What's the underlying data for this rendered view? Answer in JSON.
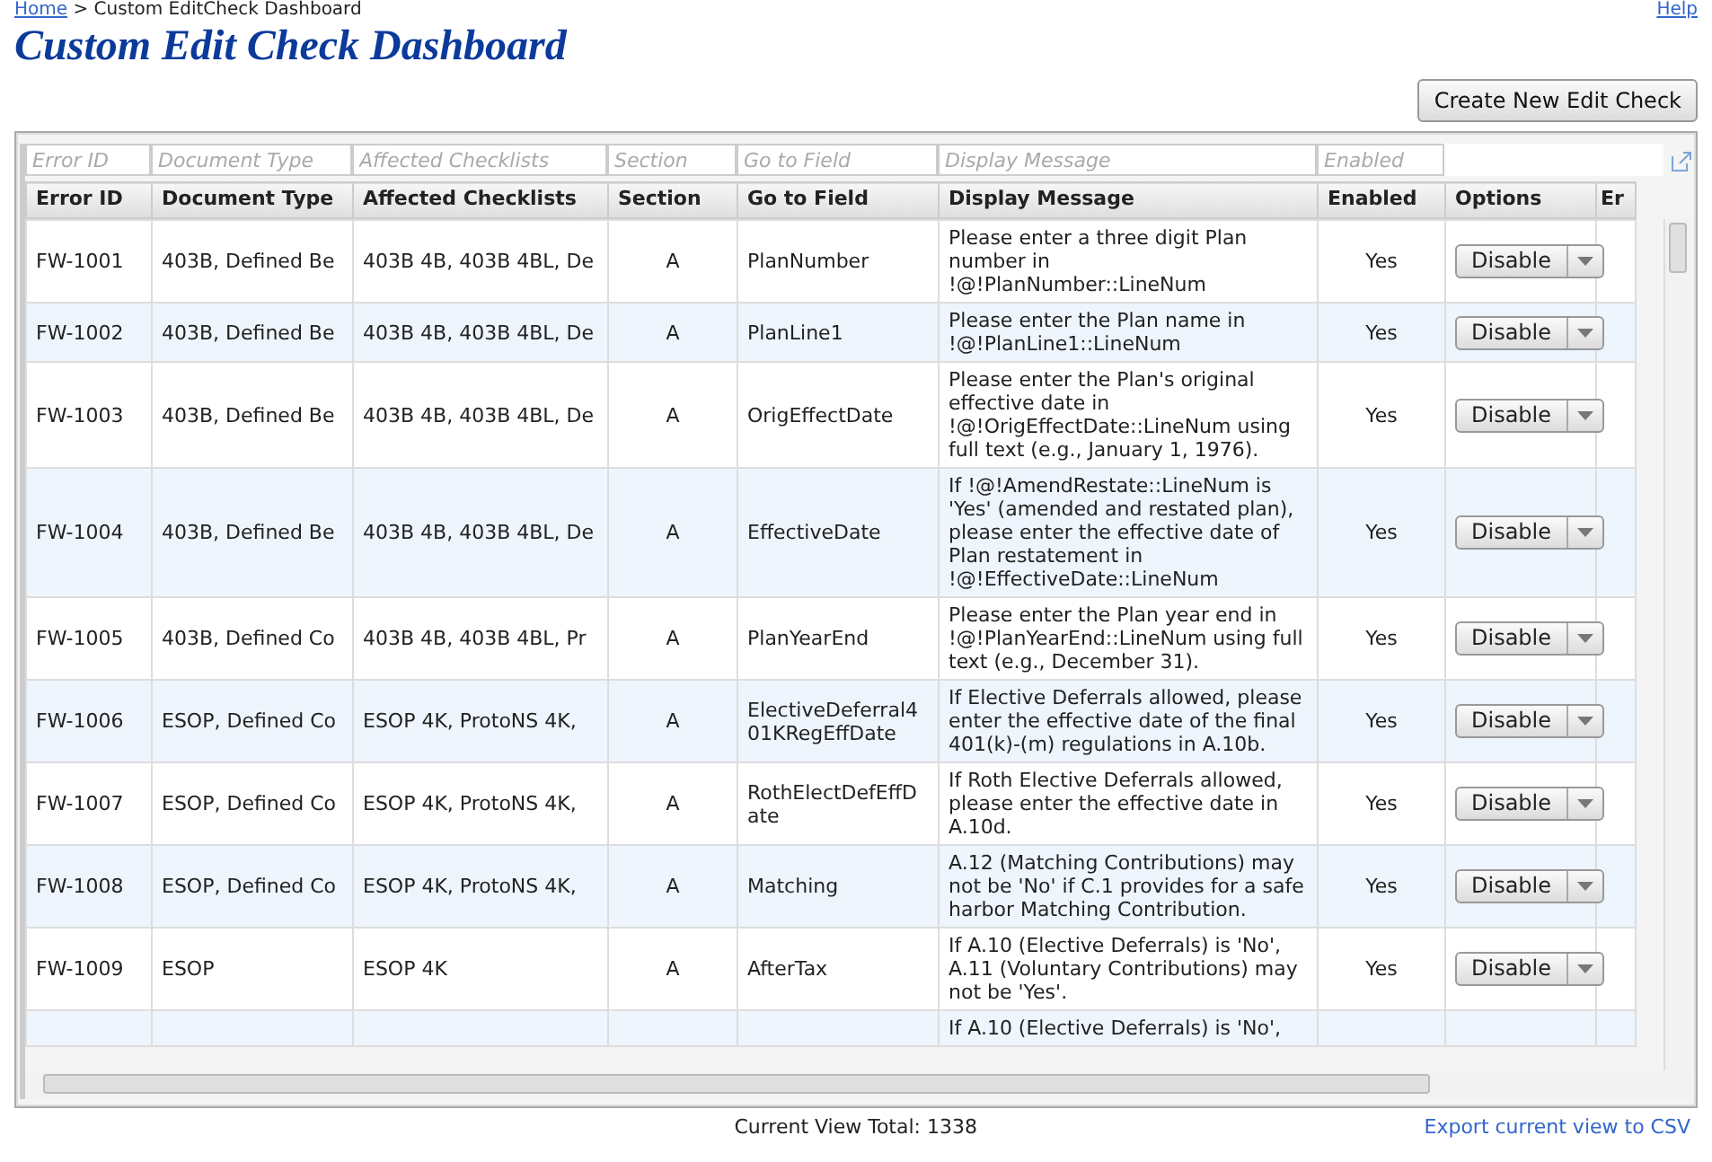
{
  "breadcrumb": {
    "home": "Home",
    "separator": ">",
    "current": "Custom EditCheck Dashboard"
  },
  "help_link": "Help",
  "title": "Custom Edit Check Dashboard",
  "create_button": "Create New Edit Check",
  "grid": {
    "filters": [
      {
        "placeholder": "Error ID"
      },
      {
        "placeholder": "Document Type"
      },
      {
        "placeholder": "Affected Checklists"
      },
      {
        "placeholder": "Section"
      },
      {
        "placeholder": "Go to Field"
      },
      {
        "placeholder": "Display Message"
      },
      {
        "placeholder": "Enabled"
      }
    ],
    "columns": [
      "Error ID",
      "Document Type",
      "Affected Checklists",
      "Section",
      "Go to Field",
      "Display Message",
      "Enabled",
      "Options",
      "Er"
    ],
    "rows": [
      {
        "error_id": "FW-1001",
        "document_type": "403B, Defined Be",
        "affected_checklists": "403B 4B, 403B 4BL, De",
        "section": "A",
        "go_to_field": "PlanNumber",
        "display_message": "Please enter a three digit Plan number in !@!PlanNumber::LineNum",
        "enabled": "Yes",
        "option": "Disable"
      },
      {
        "error_id": "FW-1002",
        "document_type": "403B, Defined Be",
        "affected_checklists": "403B 4B, 403B 4BL, De",
        "section": "A",
        "go_to_field": "PlanLine1",
        "display_message": "Please enter the Plan name in !@!PlanLine1::LineNum",
        "enabled": "Yes",
        "option": "Disable"
      },
      {
        "error_id": "FW-1003",
        "document_type": "403B, Defined Be",
        "affected_checklists": "403B 4B, 403B 4BL, De",
        "section": "A",
        "go_to_field": "OrigEffectDate",
        "display_message": "Please enter the Plan's original effective date in !@!OrigEffectDate::LineNum using full text (e.g., January 1, 1976).",
        "enabled": "Yes",
        "option": "Disable"
      },
      {
        "error_id": "FW-1004",
        "document_type": "403B, Defined Be",
        "affected_checklists": "403B 4B, 403B 4BL, De",
        "section": "A",
        "go_to_field": "EffectiveDate",
        "display_message": "If !@!AmendRestate::LineNum is 'Yes' (amended and restated plan), please enter the effective date of Plan restatement in !@!EffectiveDate::LineNum",
        "enabled": "Yes",
        "option": "Disable"
      },
      {
        "error_id": "FW-1005",
        "document_type": "403B, Defined Co",
        "affected_checklists": "403B 4B, 403B 4BL, Pr",
        "section": "A",
        "go_to_field": "PlanYearEnd",
        "display_message": "Please enter the Plan year end in !@!PlanYearEnd::LineNum using full text (e.g., December 31).",
        "enabled": "Yes",
        "option": "Disable"
      },
      {
        "error_id": "FW-1006",
        "document_type": "ESOP, Defined Co",
        "affected_checklists": "ESOP 4K, ProtoNS 4K,",
        "section": "A",
        "go_to_field": "ElectiveDeferral401KRegEffDate",
        "display_message": "If Elective Deferrals allowed, please enter the effective date of the final 401(k)-(m) regulations in A.10b.",
        "enabled": "Yes",
        "option": "Disable"
      },
      {
        "error_id": "FW-1007",
        "document_type": "ESOP, Defined Co",
        "affected_checklists": "ESOP 4K, ProtoNS 4K,",
        "section": "A",
        "go_to_field": "RothElectDefEffDate",
        "display_message": "If Roth Elective Deferrals allowed, please enter the effective date in A.10d.",
        "enabled": "Yes",
        "option": "Disable"
      },
      {
        "error_id": "FW-1008",
        "document_type": "ESOP, Defined Co",
        "affected_checklists": "ESOP 4K, ProtoNS 4K,",
        "section": "A",
        "go_to_field": "Matching",
        "display_message": "A.12 (Matching Contributions) may not be 'No' if C.1 provides for a safe harbor Matching Contribution.",
        "enabled": "Yes",
        "option": "Disable"
      },
      {
        "error_id": "FW-1009",
        "document_type": "ESOP",
        "affected_checklists": "ESOP 4K",
        "section": "A",
        "go_to_field": "AfterTax",
        "display_message": "If A.10 (Elective Deferrals) is 'No', A.11 (Voluntary Contributions) may not be 'Yes'.",
        "enabled": "Yes",
        "option": "Disable"
      }
    ],
    "partial_row": {
      "display_message": "If A.10 (Elective Deferrals) is 'No',"
    }
  },
  "footer": {
    "total": "Current View Total: 1338",
    "export_link": "Export current view to CSV"
  }
}
